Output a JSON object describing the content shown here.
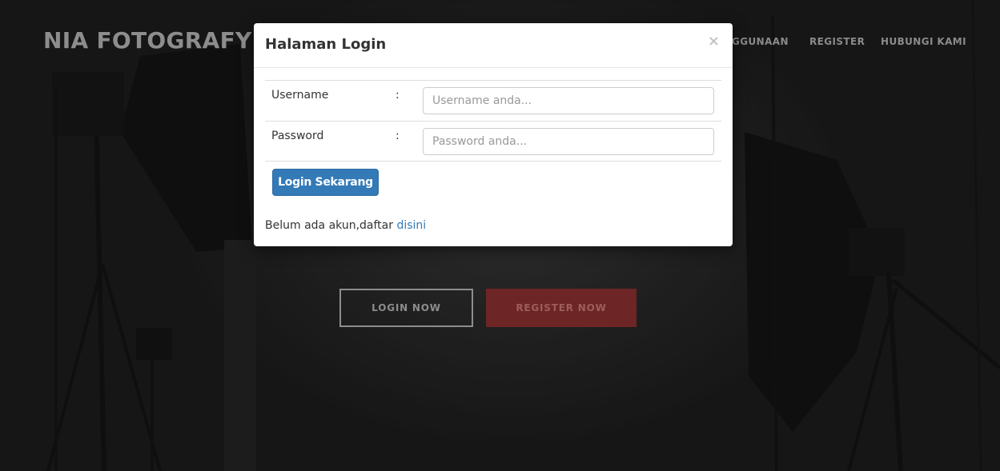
{
  "brand": {
    "name": "NIA FOTOGRAFY"
  },
  "nav": {
    "items": [
      {
        "label": "GGUNAAN"
      },
      {
        "label": "REGISTER"
      },
      {
        "label": "HUBUNGI KAMI"
      }
    ]
  },
  "hero": {
    "login_now_label": "LOGIN NOW",
    "register_now_label": "REGISTER NOW"
  },
  "modal": {
    "title": "Halaman Login",
    "close_symbol": "×",
    "username_label": "Username",
    "username_colon": ":",
    "username_placeholder": "Username anda...",
    "username_value": "",
    "password_label": "Password",
    "password_colon": ":",
    "password_placeholder": "Password anda...",
    "password_value": "",
    "submit_label": "Login Sekarang",
    "signup_text": "Belum ada akun,daftar",
    "signup_link": "disini"
  },
  "colors": {
    "primary": "#337ab7",
    "hero_register": "#6d2525"
  }
}
